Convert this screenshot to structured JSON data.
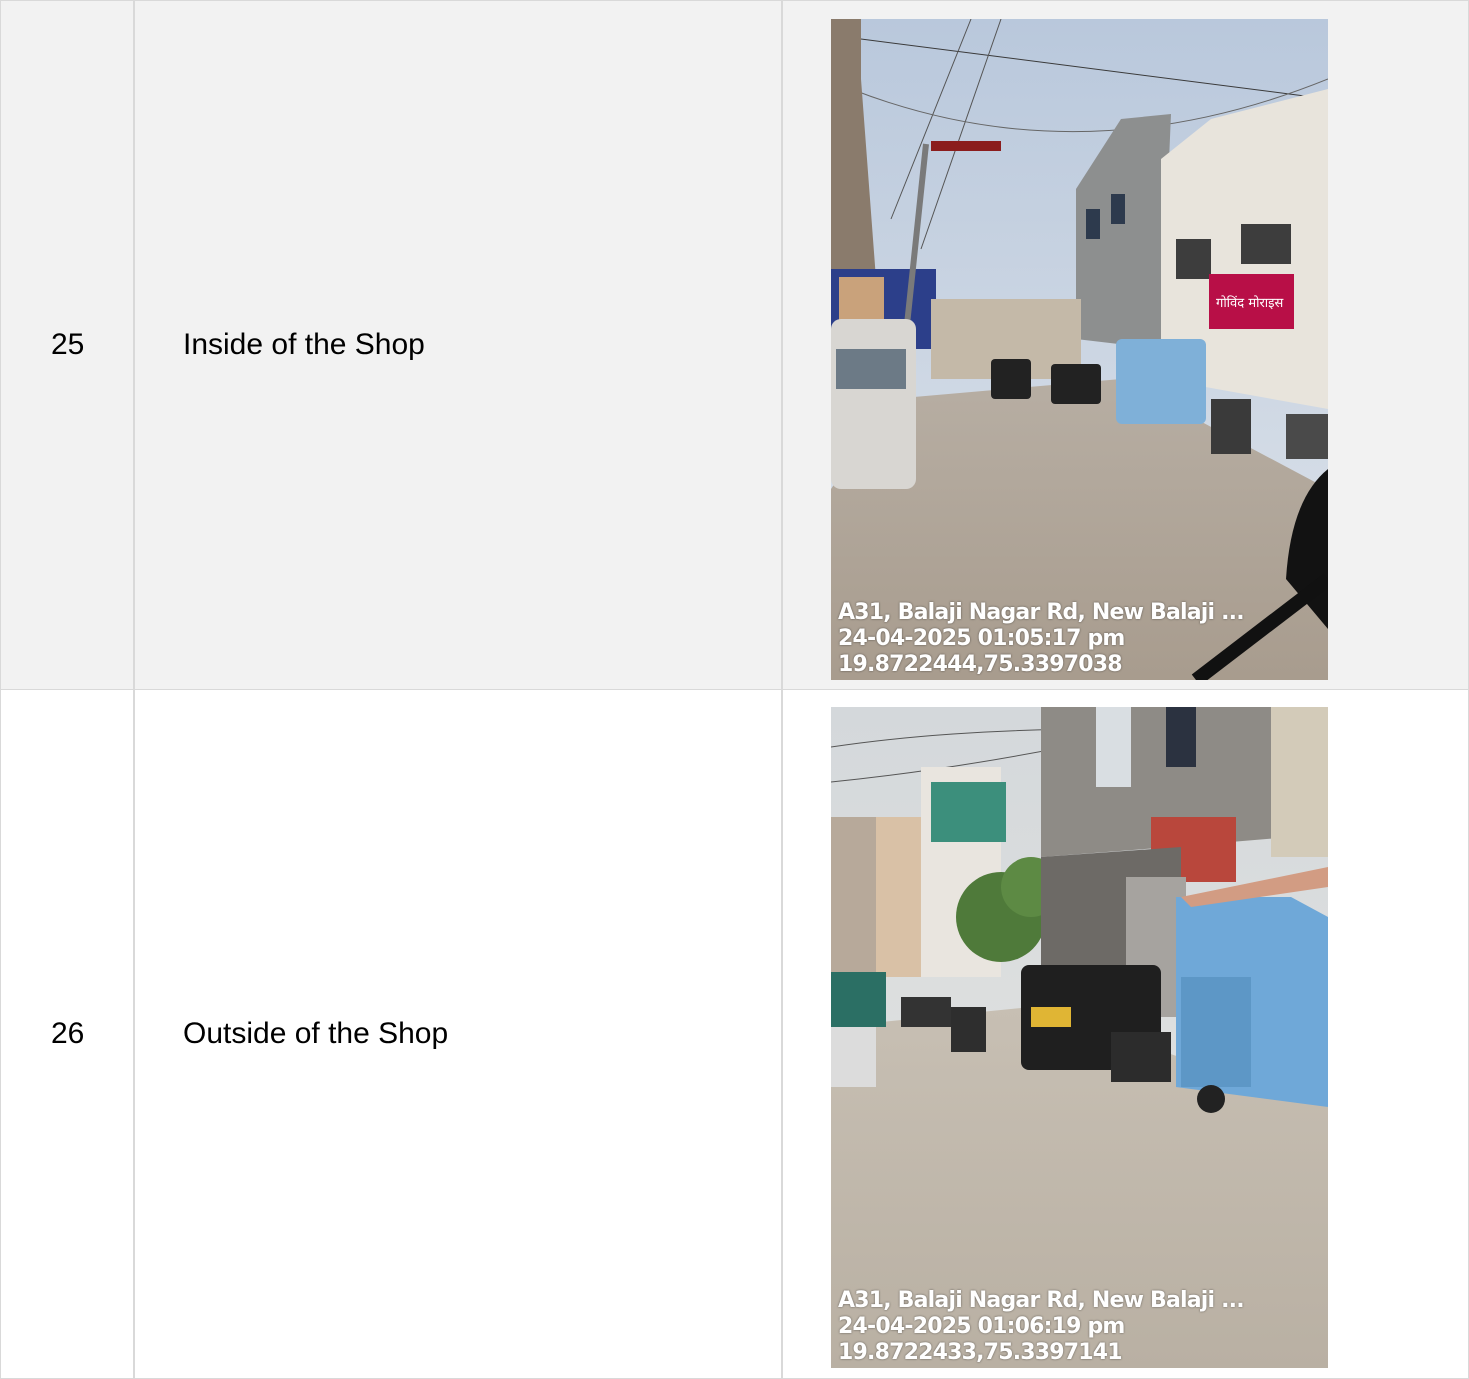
{
  "rows": [
    {
      "number": "25",
      "description": "Inside of the Shop",
      "photo": {
        "address": "A31, Balaji Nagar Rd, New Balaji ...",
        "datetime": "24-04-2025 01:05:17 pm",
        "coords": "19.8722444,75.3397038",
        "signs": [
          "गोविंद मोराइस"
        ]
      }
    },
    {
      "number": "26",
      "description": "Outside of the Shop",
      "photo": {
        "address": "A31, Balaji Nagar Rd, New Balaji ...",
        "datetime": "24-04-2025 01:06:19 pm",
        "coords": "19.8722433,75.3397141",
        "signs": []
      }
    }
  ]
}
